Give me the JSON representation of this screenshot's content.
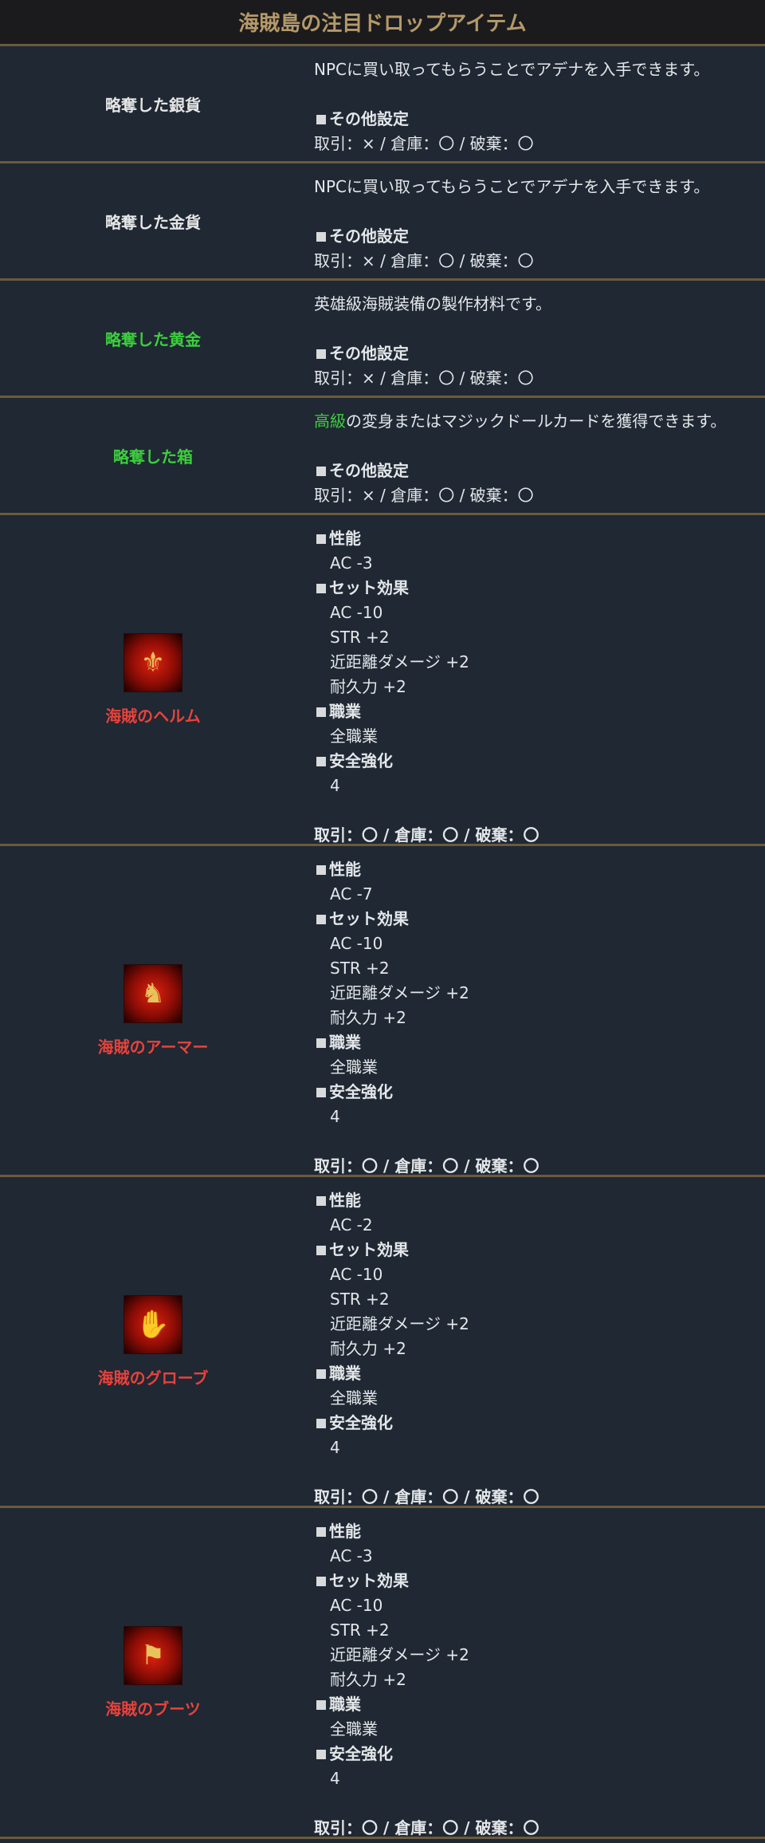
{
  "title": "海賊島の注目ドロップアイテム",
  "simple_items": [
    {
      "name": "略奪した銀貨",
      "desc": "NPCに買い取ってもらうことでアデナを入手できます。",
      "other_label": "その他設定",
      "trade": "取引：× / 倉庫：〇 / 破棄：〇"
    },
    {
      "name": "略奪した金貨",
      "desc": "NPCに買い取ってもらうことでアデナを入手できます。",
      "other_label": "その他設定",
      "trade": "取引：× / 倉庫：〇 / 破棄：〇"
    },
    {
      "name": "略奪した黄金",
      "desc": "英雄級海賊装備の製作材料です。",
      "other_label": "その他設定",
      "trade": "取引：× / 倉庫：〇 / 破棄：〇"
    },
    {
      "name": "略奪した箱",
      "desc_highlight": "高級",
      "desc": "の変身またはマジックドールカードを獲得できます。",
      "other_label": "その他設定",
      "trade": "取引：× / 倉庫：〇 / 破棄：〇"
    }
  ],
  "equip_items": [
    {
      "name": "海賊のヘルム",
      "icon": "pirate-hat-icon",
      "perf_label": "性能",
      "ac": "AC -3",
      "set_label": "セット効果",
      "set": [
        "AC -10",
        "STR +2",
        "近距離ダメージ +2",
        "耐久力 +2"
      ],
      "class_label": "職業",
      "class": "全職業",
      "safe_label": "安全強化",
      "safe": "4",
      "trade": "取引：〇 / 倉庫：〇 / 破棄：〇"
    },
    {
      "name": "海賊のアーマー",
      "icon": "pirate-armor-icon",
      "perf_label": "性能",
      "ac": "AC -7",
      "set_label": "セット効果",
      "set": [
        "AC -10",
        "STR +2",
        "近距離ダメージ +2",
        "耐久力 +2"
      ],
      "class_label": "職業",
      "class": "全職業",
      "safe_label": "安全強化",
      "safe": "4",
      "trade": "取引：〇 / 倉庫：〇 / 破棄：〇"
    },
    {
      "name": "海賊のグローブ",
      "icon": "pirate-glove-icon",
      "perf_label": "性能",
      "ac": "AC -2",
      "set_label": "セット効果",
      "set": [
        "AC -10",
        "STR +2",
        "近距離ダメージ +2",
        "耐久力 +2"
      ],
      "class_label": "職業",
      "class": "全職業",
      "safe_label": "安全強化",
      "safe": "4",
      "trade": "取引：〇 / 倉庫：〇 / 破棄：〇"
    },
    {
      "name": "海賊のブーツ",
      "icon": "pirate-boots-icon",
      "perf_label": "性能",
      "ac": "AC -3",
      "set_label": "セット効果",
      "set": [
        "AC -10",
        "STR +2",
        "近距離ダメージ +2",
        "耐久力 +2"
      ],
      "class_label": "職業",
      "class": "全職業",
      "safe_label": "安全強化",
      "safe": "4",
      "trade": "取引：〇 / 倉庫：〇 / 破棄：〇"
    }
  ]
}
